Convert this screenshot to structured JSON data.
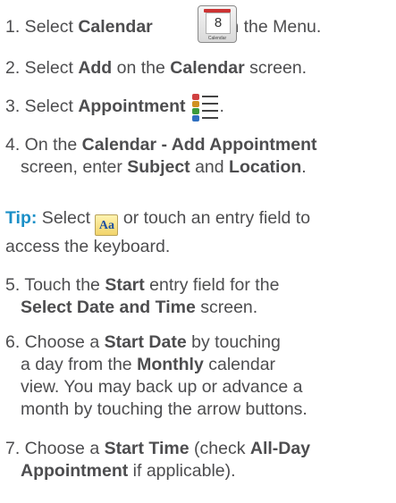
{
  "step1": {
    "num": "1.",
    "pre": " Select ",
    "bold1": "Calendar",
    "post": " from the Menu.",
    "icon_caption": "Calendar",
    "icon_day": "8"
  },
  "step2": {
    "num": "2.",
    "pre": " Select ",
    "bold1": "Add",
    "mid": " on the ",
    "bold2": "Calendar",
    "post": " screen."
  },
  "step3": {
    "num": "3.",
    "pre": " Select ",
    "bold1": "Appointment",
    "post": "."
  },
  "step4": {
    "num": "4.",
    "pre": " On the ",
    "bold1": "Calendar - Add Appointment",
    "line2_pre": "screen, enter ",
    "bold2": "Subject",
    "mid": " and ",
    "bold3": "Location",
    "post": "."
  },
  "tip": {
    "label": "Tip:",
    "pre": " Select ",
    "icon_text": "Aa",
    "post": " or touch an entry field to",
    "line2": "access the keyboard."
  },
  "step5": {
    "num": "5.",
    "pre": " Touch the ",
    "bold1": "Start",
    "post": " entry field for the",
    "bold2": "Select Date and Time",
    "post2": " screen."
  },
  "step6": {
    "num": "6.",
    "pre": " Choose a ",
    "bold1": "Start Date",
    "post": " by touching",
    "line2_pre": "a day from the ",
    "bold2": "Monthly",
    "line2_post": " calendar",
    "line3": "view. You may back up or advance a",
    "line4": "month by touching the arrow buttons."
  },
  "step7": {
    "num": "7.",
    "pre": " Choose a ",
    "bold1": "Start Time",
    "mid": " (check ",
    "bold2": "All-Day",
    "bold3": "Appointment",
    "post": " if applicable)."
  }
}
